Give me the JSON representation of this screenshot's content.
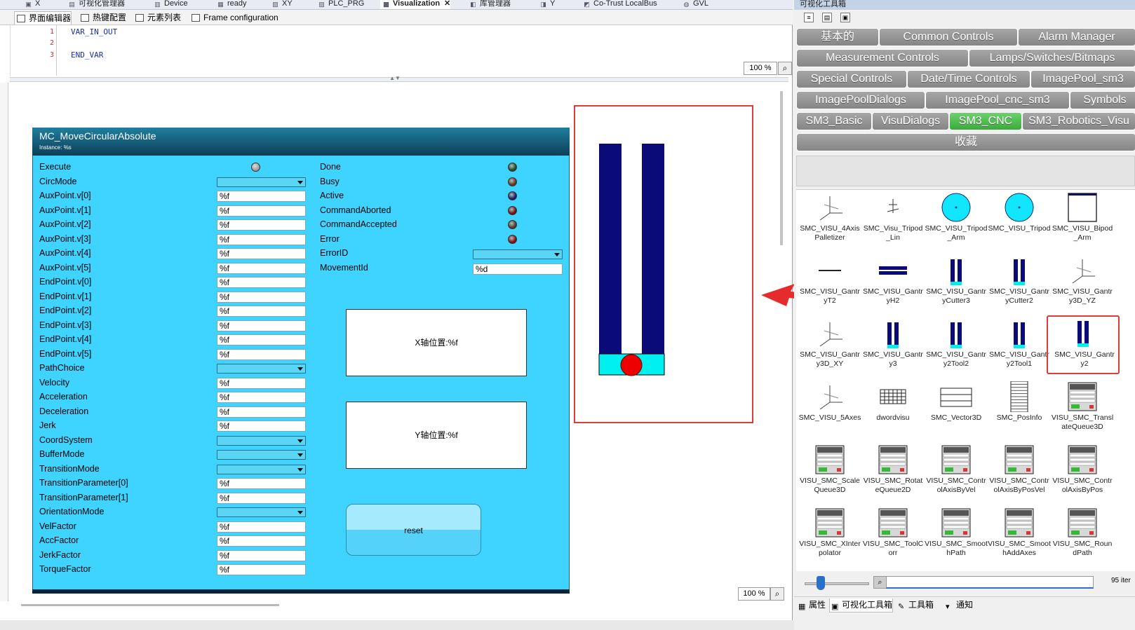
{
  "editor_tabs": [
    {
      "label": "X",
      "active": false
    },
    {
      "label": "可视化管理器",
      "active": false
    },
    {
      "label": "Device",
      "active": false
    },
    {
      "label": "ready",
      "active": false
    },
    {
      "label": "XY",
      "active": false
    },
    {
      "label": "PLC_PRG",
      "active": false
    },
    {
      "label": "Visualization",
      "active": true,
      "closable": true,
      "close_glyph": "✕"
    },
    {
      "label": "库管理器",
      "active": false
    },
    {
      "label": "Y",
      "active": false
    },
    {
      "label": "Co-Trust LocalBus",
      "active": false
    },
    {
      "label": "GVL",
      "active": false
    }
  ],
  "sub_tabs": [
    {
      "label": "界面编辑器",
      "active": true
    },
    {
      "label": "热键配置",
      "active": false
    },
    {
      "label": "元素列表",
      "active": false
    },
    {
      "label": "Frame configuration",
      "active": false
    }
  ],
  "code": {
    "lines": [
      {
        "num": "1",
        "text": "VAR_IN_OUT"
      },
      {
        "num": "2",
        "text": ""
      },
      {
        "num": "3",
        "text": "END_VAR"
      }
    ],
    "zoom": "100 %"
  },
  "canvas_zoom": "100 %",
  "fb": {
    "title": "MC_MoveCircularAbsolute",
    "instance": "Instance: %s",
    "inputs": [
      {
        "label": "Execute",
        "kind": "led"
      },
      {
        "label": "CircMode",
        "kind": "combo"
      },
      {
        "label": "AuxPoint.v[0]",
        "kind": "field",
        "value": "%f"
      },
      {
        "label": "AuxPoint.v[1]",
        "kind": "field",
        "value": "%f"
      },
      {
        "label": "AuxPoint.v[2]",
        "kind": "field",
        "value": "%f"
      },
      {
        "label": "AuxPoint.v[3]",
        "kind": "field",
        "value": "%f"
      },
      {
        "label": "AuxPoint.v[4]",
        "kind": "field",
        "value": "%f"
      },
      {
        "label": "AuxPoint.v[5]",
        "kind": "field",
        "value": "%f"
      },
      {
        "label": "EndPoint.v[0]",
        "kind": "field",
        "value": "%f"
      },
      {
        "label": "EndPoint.v[1]",
        "kind": "field",
        "value": "%f"
      },
      {
        "label": "EndPoint.v[2]",
        "kind": "field",
        "value": "%f"
      },
      {
        "label": "EndPoint.v[3]",
        "kind": "field",
        "value": "%f"
      },
      {
        "label": "EndPoint.v[4]",
        "kind": "field",
        "value": "%f"
      },
      {
        "label": "EndPoint.v[5]",
        "kind": "field",
        "value": "%f"
      },
      {
        "label": "PathChoice",
        "kind": "combo"
      },
      {
        "label": "Velocity",
        "kind": "field",
        "value": "%f"
      },
      {
        "label": "Acceleration",
        "kind": "field",
        "value": "%f"
      },
      {
        "label": "Deceleration",
        "kind": "field",
        "value": "%f"
      },
      {
        "label": "Jerk",
        "kind": "field",
        "value": "%f"
      },
      {
        "label": "CoordSystem",
        "kind": "combo"
      },
      {
        "label": "BufferMode",
        "kind": "combo"
      },
      {
        "label": "TransitionMode",
        "kind": "combo"
      },
      {
        "label": "TransitionParameter[0]",
        "kind": "field",
        "value": "%f"
      },
      {
        "label": "TransitionParameter[1]",
        "kind": "field",
        "value": "%f"
      },
      {
        "label": "OrientationMode",
        "kind": "combo"
      },
      {
        "label": "VelFactor",
        "kind": "field",
        "value": "%f"
      },
      {
        "label": "AccFactor",
        "kind": "field",
        "value": "%f"
      },
      {
        "label": "JerkFactor",
        "kind": "field",
        "value": "%f"
      },
      {
        "label": "TorqueFactor",
        "kind": "field",
        "value": "%f"
      }
    ],
    "outputs": [
      {
        "label": "Done",
        "kind": "led",
        "color": "#1f4a2a"
      },
      {
        "label": "Busy",
        "kind": "led",
        "color": "#5a3a1a"
      },
      {
        "label": "Active",
        "kind": "led",
        "color": "#1a1a6a"
      },
      {
        "label": "CommandAborted",
        "kind": "led",
        "color": "#6a1010"
      },
      {
        "label": "CommandAccepted",
        "kind": "led",
        "color": "#4a3a2a"
      },
      {
        "label": "Error",
        "kind": "led",
        "color": "#7a1010"
      },
      {
        "label": "ErrorID",
        "kind": "combo"
      },
      {
        "label": "MovementId",
        "kind": "field",
        "value": "%d"
      }
    ],
    "x_box": "X轴位置:%f",
    "y_box": "Y轴位置:%f",
    "reset": "reset"
  },
  "gantry_preview": {
    "column_color": "#0a0a78",
    "base_color": "#00f0f0",
    "tool_color": "#ee0000",
    "frame_color": "#e03a3a"
  },
  "toolbox": {
    "title": "可视化工具箱",
    "categories": [
      {
        "label": "基本的"
      },
      {
        "label": "Common Controls"
      },
      {
        "label": "Alarm Manager"
      },
      {
        "label": "Measurement Controls"
      },
      {
        "label": "Lamps/Switches/Bitmaps"
      },
      {
        "label": "Special Controls"
      },
      {
        "label": "Date/Time Controls"
      },
      {
        "label": "ImagePool_sm3"
      },
      {
        "label": "ImagePoolDialogs"
      },
      {
        "label": "ImagePool_cnc_sm3"
      },
      {
        "label": "Symbols"
      },
      {
        "label": "SM3_Basic"
      },
      {
        "label": "VisuDialogs"
      },
      {
        "label": "SM3_CNC",
        "selected": true
      },
      {
        "label": "SM3_Robotics_Visu"
      },
      {
        "label": "收藏"
      }
    ],
    "items": [
      {
        "name": "SMC_VISU_4AxisPalletizer",
        "icon": "axes"
      },
      {
        "name": "SMC_Visu_Tripod_Lin",
        "icon": "tripod-lin"
      },
      {
        "name": "SMC_VISU_Tripod_Arm",
        "icon": "circle"
      },
      {
        "name": "SMC_VISU_Tripod",
        "icon": "circle"
      },
      {
        "name": "SMC_VISU_Bipod_Arm",
        "icon": "frame"
      },
      {
        "name": "SMC_VISU_GantryT2",
        "icon": "line"
      },
      {
        "name": "SMC_VISU_GantryH2",
        "icon": "h2"
      },
      {
        "name": "SMC_VISU_GantryCutter3",
        "icon": "gantry"
      },
      {
        "name": "SMC_VISU_GantryCutter2",
        "icon": "gantry"
      },
      {
        "name": "SMC_VISU_Gantry3D_YZ",
        "icon": "axes"
      },
      {
        "name": "SMC_VISU_Gantry3D_XY",
        "icon": "axes"
      },
      {
        "name": "SMC_VISU_Gantry3",
        "icon": "gantry"
      },
      {
        "name": "SMC_VISU_Gantry2Tool2",
        "icon": "gantry"
      },
      {
        "name": "SMC_VISU_Gantry2Tool1",
        "icon": "gantry"
      },
      {
        "name": "SMC_VISU_Gantry2",
        "icon": "gantry",
        "selected": true
      },
      {
        "name": "SMC_VISU_5Axes",
        "icon": "axes"
      },
      {
        "name": "dwordvisu",
        "icon": "grid"
      },
      {
        "name": "SMC_Vector3D",
        "icon": "vector"
      },
      {
        "name": "SMC_PosInfo",
        "icon": "list"
      },
      {
        "name": "VISU_SMC_TranslateQueue3D",
        "icon": "panel"
      },
      {
        "name": "VISU_SMC_ScaleQueue3D",
        "icon": "panel"
      },
      {
        "name": "VISU_SMC_RotateQueue2D",
        "icon": "panel"
      },
      {
        "name": "VISU_SMC_ControlAxisByVel",
        "icon": "panel"
      },
      {
        "name": "VISU_SMC_ControlAxisByPosVel",
        "icon": "panel"
      },
      {
        "name": "VISU_SMC_ControlAxisByPos",
        "icon": "panel"
      },
      {
        "name": "VISU_SMC_XInterpolator",
        "icon": "panel"
      },
      {
        "name": "VISU_SMC_ToolCorr",
        "icon": "panel"
      },
      {
        "name": "VISU_SMC_SmoothPath",
        "icon": "panel"
      },
      {
        "name": "VISU_SMC_SmoothAddAxes",
        "icon": "panel"
      },
      {
        "name": "VISU_SMC_RoundPath",
        "icon": "panel"
      }
    ],
    "zoom_level": 0.25,
    "search_value": "",
    "item_count": "95 iter"
  },
  "bottom_tabs": [
    {
      "label": "属性",
      "active": false
    },
    {
      "label": "可视化工具箱",
      "active": true
    },
    {
      "label": "工具箱",
      "active": false
    },
    {
      "label": "通知",
      "active": false
    }
  ]
}
